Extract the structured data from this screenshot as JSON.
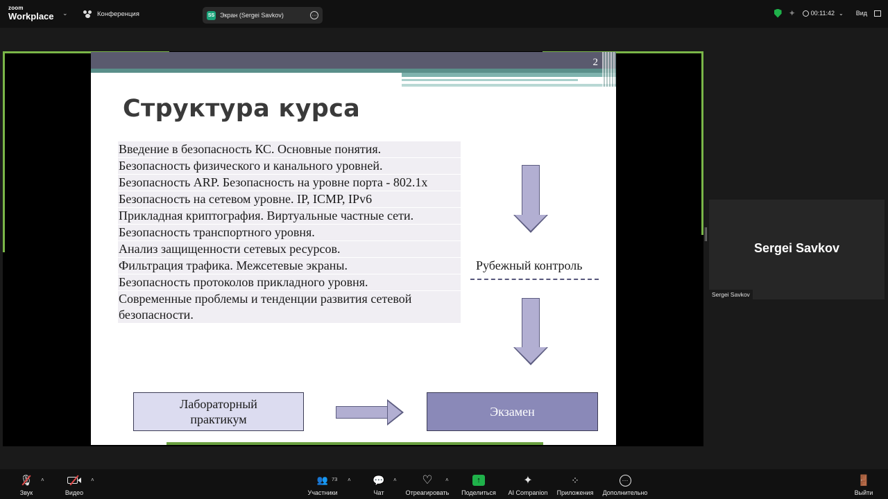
{
  "topbar": {
    "logo_line1": "zoom",
    "logo_line2": "Workplace",
    "conference_label": "Конференция",
    "screen_share_badge": "SS",
    "screen_share_label": "Экран (Sergei Savkov)",
    "timer": "00:11:42",
    "view_label": "Вид",
    "security_color": "#1fb14a"
  },
  "slide": {
    "page_number": "2",
    "title": "Структура курса",
    "topics": [
      "Введение в безопасность КС. Основные понятия.",
      "Безопасность физического и канального уровней.",
      "Безопасность ARP. Безопасность на уровне порта - 802.1x",
      "Безопасность на сетевом уровне. IP, ICMP, IPv6",
      "Прикладная криптография. Виртуальные частные сети.",
      "Безопасность транспортного уровня.",
      "Анализ защищенности сетевых ресурсов.",
      "Фильтрация трафика. Межсетевые экраны.",
      "Безопасность протоколов прикладного уровня.",
      "Современные проблемы и тенденции развития сетевой безопасности."
    ],
    "checkpoint_label": "Рубежный контроль",
    "lab_label": "Лабораторный практикум",
    "exam_label": "Экзамен"
  },
  "participant": {
    "name": "Sergei Savkov",
    "label": "Sergei Savkov"
  },
  "toolbar": {
    "audio": "Звук",
    "video": "Видео",
    "participants": "Участники",
    "participants_count": "73",
    "chat": "Чат",
    "react": "Отреагировать",
    "share": "Поделиться",
    "ai": "AI Companion",
    "apps": "Приложения",
    "more": "Дополнительно",
    "leave": "Выйти"
  }
}
